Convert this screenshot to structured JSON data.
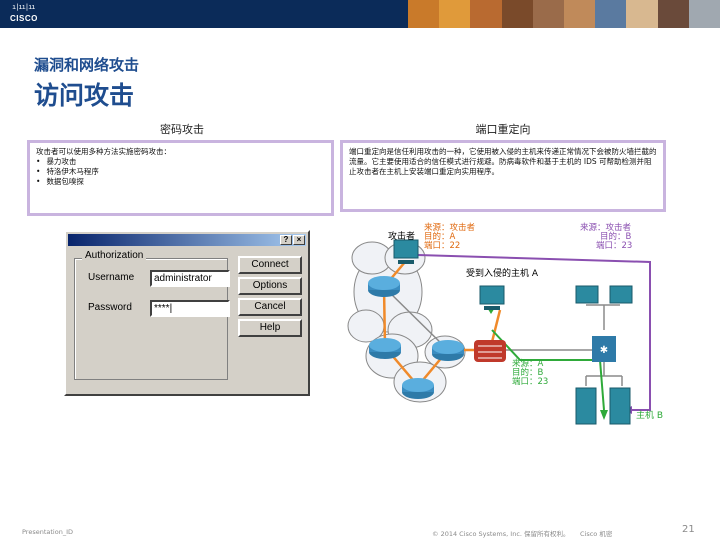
{
  "brand": {
    "logo_text": "CISCO"
  },
  "header": {
    "photo_colors": [
      "#c97a2a",
      "#e09a3a",
      "#b96a30",
      "#7a4a2a",
      "#9a6b4a",
      "#c08a5a",
      "#5a7aa0",
      "#d8b890",
      "#6a4a3a",
      "#a0a8b0"
    ]
  },
  "slide": {
    "section": "漏洞和网络攻击",
    "title": "访问攻击"
  },
  "left_panel": {
    "heading": "密码攻击",
    "intro": "攻击者可以使用多种方法实施密码攻击：",
    "bullets": [
      "暴力攻击",
      "特洛伊木马程序",
      "数据包嗅探"
    ]
  },
  "right_panel": {
    "heading": "端口重定向",
    "body": "端口重定向是信任利用攻击的一种，它使用被入侵的主机来传递正常情况下会被防火墙拦截的流量。它主要使用适合的信任模式进行规避。防病毒软件和基于主机的 IDS 可帮助检测并阻止攻击者在主机上安装端口重定向实用程序。"
  },
  "dialog": {
    "help_btn": "?",
    "close_btn": "×",
    "group_label": "Authorization",
    "username_label": "Username",
    "username_value": "administrator",
    "password_label": "Password",
    "password_value": "****|",
    "buttons": {
      "connect": "Connect",
      "options": "Options",
      "cancel": "Cancel",
      "help": "Help"
    }
  },
  "diagram": {
    "attacker_label": "攻击者",
    "src_a": "来源：攻击者",
    "dst_a": "目的：A",
    "port_a": "端口：22",
    "compromised_label": "受到入侵的主机 A",
    "src_b": "来源：攻击者",
    "dst_b": "目的：B",
    "port_b": "端口：23",
    "src_c": "来源：A",
    "dst_c": "目的：B",
    "port_c": "端口：23",
    "host_b_label": "主机 B"
  },
  "footer": {
    "left": "Presentation_ID",
    "center": "© 2014 Cisco Systems, Inc. 保留所有权利。",
    "right": "Cisco 机密",
    "page": "21"
  }
}
